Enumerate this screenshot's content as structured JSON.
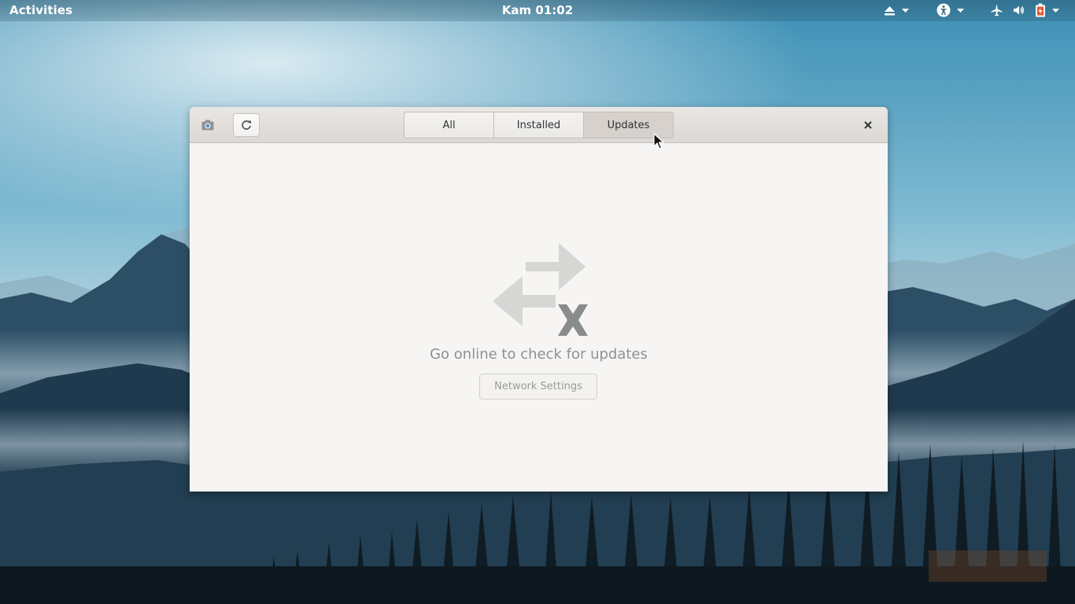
{
  "topbar": {
    "activities": "Activities",
    "clock": "Kam 01:02",
    "tray_icons": [
      "eject-icon",
      "accessibility-icon",
      "airplane-mode-icon",
      "volume-icon",
      "battery-icon"
    ]
  },
  "window": {
    "tabs": [
      {
        "label": "All",
        "active": false
      },
      {
        "label": "Installed",
        "active": false
      },
      {
        "label": "Updates",
        "active": true
      }
    ],
    "empty_state": {
      "icon": "network-offline-icon",
      "title": "Go online to check for updates",
      "button_label": "Network Settings"
    }
  },
  "colors": {
    "window_bg": "#f6f5f4",
    "headerbar_bg": "#dcd8d4",
    "active_tab_bg": "#d6d1cc",
    "muted_text": "#8d9191"
  }
}
